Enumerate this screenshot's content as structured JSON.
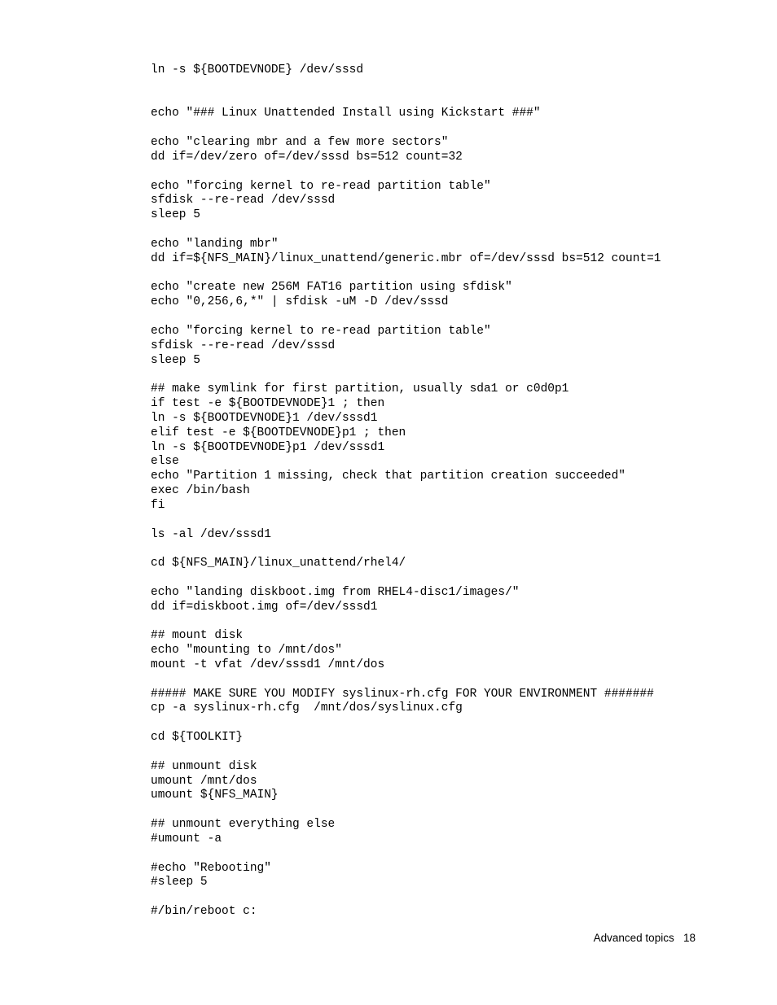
{
  "code": "ln -s ${BOOTDEVNODE} /dev/sssd\n\n\necho \"### Linux Unattended Install using Kickstart ###\"\n\necho \"clearing mbr and a few more sectors\"\ndd if=/dev/zero of=/dev/sssd bs=512 count=32\n\necho \"forcing kernel to re-read partition table\"\nsfdisk --re-read /dev/sssd\nsleep 5\n\necho \"landing mbr\"\ndd if=${NFS_MAIN}/linux_unattend/generic.mbr of=/dev/sssd bs=512 count=1\n\necho \"create new 256M FAT16 partition using sfdisk\"\necho \"0,256,6,*\" | sfdisk -uM -D /dev/sssd\n\necho \"forcing kernel to re-read partition table\"\nsfdisk --re-read /dev/sssd\nsleep 5\n\n## make symlink for first partition, usually sda1 or c0d0p1\nif test -e ${BOOTDEVNODE}1 ; then\nln -s ${BOOTDEVNODE}1 /dev/sssd1\nelif test -e ${BOOTDEVNODE}p1 ; then\nln -s ${BOOTDEVNODE}p1 /dev/sssd1\nelse\necho \"Partition 1 missing, check that partition creation succeeded\"\nexec /bin/bash\nfi\n\nls -al /dev/sssd1\n\ncd ${NFS_MAIN}/linux_unattend/rhel4/\n\necho \"landing diskboot.img from RHEL4-disc1/images/\"\ndd if=diskboot.img of=/dev/sssd1\n\n## mount disk\necho \"mounting to /mnt/dos\"\nmount -t vfat /dev/sssd1 /mnt/dos\n\n##### MAKE SURE YOU MODIFY syslinux-rh.cfg FOR YOUR ENVIRONMENT #######\ncp -a syslinux-rh.cfg  /mnt/dos/syslinux.cfg\n\ncd ${TOOLKIT}\n\n## unmount disk\numount /mnt/dos\numount ${NFS_MAIN}\n\n## unmount everything else\n#umount -a\n\n#echo \"Rebooting\"\n#sleep 5\n\n#/bin/reboot c:",
  "footer": {
    "section": "Advanced topics",
    "page": "18"
  }
}
